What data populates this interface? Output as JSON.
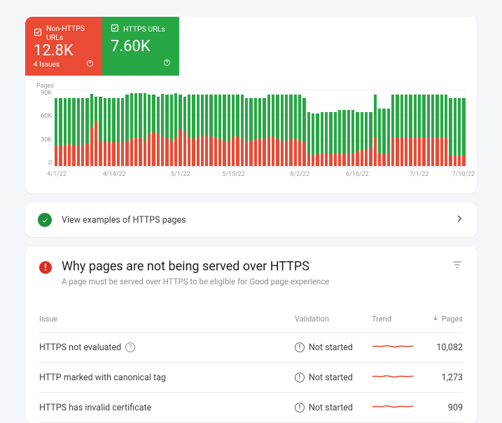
{
  "summary": {
    "nonHttps": {
      "label": "Non-HTTPS URLs",
      "value": "12.8K",
      "issues": "4 Issues"
    },
    "https": {
      "label": "HTTPS URLs",
      "value": "7.60K"
    }
  },
  "chart": {
    "yAxisTitle": "Pages",
    "yTicks": [
      "90K",
      "60K",
      "30K",
      "0"
    ],
    "xTicks": [
      {
        "label": "4/1/22",
        "pos": 0
      },
      {
        "label": "4/14/22",
        "pos": 13
      },
      {
        "label": "5/1/22",
        "pos": 28
      },
      {
        "label": "5/15/22",
        "pos": 40
      },
      {
        "label": "6/2/22",
        "pos": 55
      },
      {
        "label": "6/16/22",
        "pos": 68
      },
      {
        "label": "7/1/22",
        "pos": 82
      },
      {
        "label": "7/10/22",
        "pos": 92
      }
    ]
  },
  "chart_data": {
    "type": "bar",
    "stacked": true,
    "title": "Pages",
    "ylabel": "Pages",
    "ylim": [
      0,
      90000
    ],
    "categories_start": "4/1/22",
    "categories_end": "7/10/22",
    "series": [
      {
        "name": "Non-HTTPS URLs",
        "color": "#E94B35",
        "values": [
          24000,
          24000,
          25000,
          26000,
          25000,
          25000,
          25000,
          27000,
          45000,
          52000,
          30000,
          28000,
          28000,
          28000,
          28000,
          28000,
          30000,
          32000,
          34000,
          34000,
          30000,
          38000,
          40000,
          38000,
          35000,
          34000,
          30000,
          34000,
          44000,
          40000,
          34000,
          32000,
          35000,
          35000,
          36000,
          35000,
          34000,
          32000,
          30000,
          30000,
          35000,
          35000,
          32000,
          30000,
          30000,
          32000,
          32000,
          32000,
          35000,
          35000,
          32000,
          30000,
          30000,
          32000,
          32000,
          30000,
          28000,
          14000,
          12000,
          14000,
          15000,
          15000,
          15000,
          15000,
          14000,
          14000,
          14000,
          14000,
          18000,
          18000,
          20000,
          22000,
          34000,
          14000,
          14000,
          14000,
          34000,
          34000,
          34000,
          34000,
          34000,
          34000,
          34000,
          34000,
          34000,
          34000,
          34000,
          34000,
          34000,
          12000,
          12000,
          12000,
          12000
        ]
      },
      {
        "name": "HTTPS URLs",
        "color": "#28A745",
        "values": [
          56000,
          56000,
          55000,
          54000,
          55000,
          55000,
          55000,
          53000,
          40000,
          30000,
          52000,
          52000,
          52000,
          52000,
          52000,
          52000,
          54000,
          54000,
          52000,
          52000,
          56000,
          46000,
          44000,
          44000,
          50000,
          50000,
          54000,
          52000,
          40000,
          42000,
          50000,
          52000,
          49000,
          49000,
          48000,
          49000,
          50000,
          52000,
          54000,
          54000,
          49000,
          49000,
          52000,
          50000,
          50000,
          48000,
          48000,
          48000,
          49000,
          49000,
          52000,
          54000,
          54000,
          52000,
          52000,
          54000,
          52000,
          50000,
          50000,
          48000,
          49000,
          49000,
          49000,
          49000,
          52000,
          52000,
          52000,
          52000,
          46000,
          46000,
          44000,
          42000,
          50000,
          54000,
          54000,
          54000,
          50000,
          50000,
          50000,
          50000,
          50000,
          50000,
          50000,
          50000,
          50000,
          50000,
          50000,
          50000,
          50000,
          68000,
          68000,
          68000,
          68000
        ]
      }
    ]
  },
  "examplesRow": {
    "label": "View examples of HTTPS pages"
  },
  "whySection": {
    "title": "Why pages are not being served over HTTPS",
    "subtitle": "A page must be served over HTTPS to be eligible for Good page experience",
    "columns": {
      "issue": "Issue",
      "validation": "Validation",
      "trend": "Trend",
      "pages": "Pages"
    },
    "rows": [
      {
        "issue": "HTTPS not evaluated",
        "hasHelp": true,
        "validation": "Not started",
        "pages": "10,082"
      },
      {
        "issue": "HTTP marked with canonical tag",
        "hasHelp": false,
        "validation": "Not started",
        "pages": "1,273"
      },
      {
        "issue": "HTTPS has invalid certificate",
        "hasHelp": false,
        "validation": "Not started",
        "pages": "909"
      }
    ]
  }
}
